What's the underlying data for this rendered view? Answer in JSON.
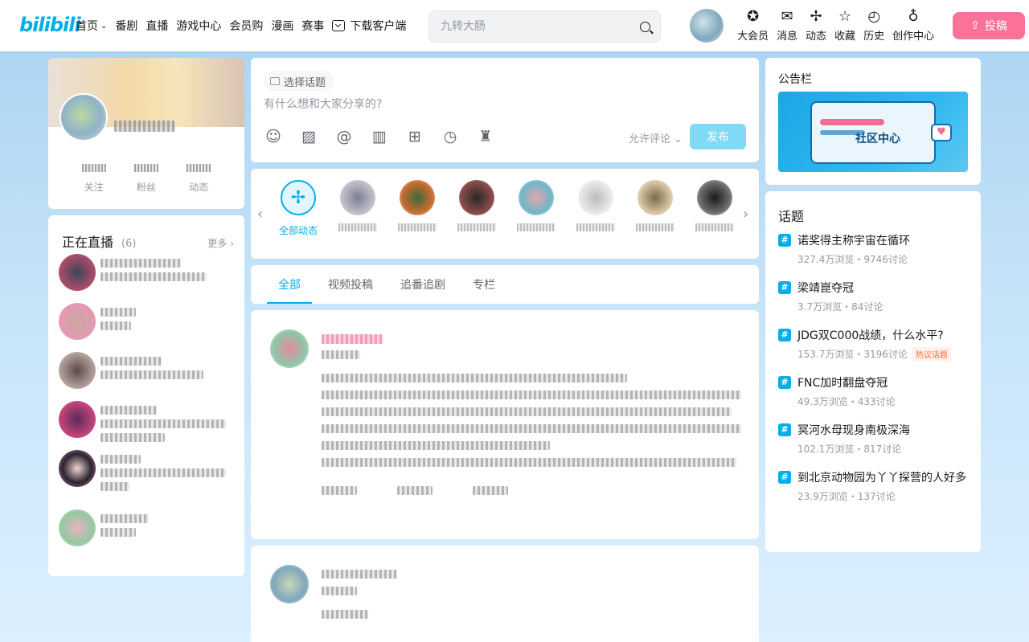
{
  "header": {
    "logo": "bilibili",
    "nav": [
      {
        "label": "首页",
        "chevron": true
      },
      {
        "label": "番剧"
      },
      {
        "label": "直播"
      },
      {
        "label": "游戏中心"
      },
      {
        "label": "会员购"
      },
      {
        "label": "漫画"
      },
      {
        "label": "赛事"
      },
      {
        "label": "下载客户端",
        "icon": "download-icon"
      }
    ],
    "search_placeholder": "九转大肠",
    "right_nav": [
      {
        "label": "大会员",
        "icon": "vip-icon",
        "glyph": "✪"
      },
      {
        "label": "消息",
        "icon": "message-icon",
        "glyph": "✉"
      },
      {
        "label": "动态",
        "icon": "dynamic-icon",
        "glyph": "✢"
      },
      {
        "label": "收藏",
        "icon": "favorite-icon",
        "glyph": "☆"
      },
      {
        "label": "历史",
        "icon": "history-icon",
        "glyph": "◴"
      },
      {
        "label": "创作中心",
        "icon": "bulb-icon",
        "glyph": "♁"
      }
    ],
    "upload_label": "投稿"
  },
  "profile": {
    "stats": [
      {
        "label": "关注"
      },
      {
        "label": "粉丝"
      },
      {
        "label": "动态"
      }
    ]
  },
  "live": {
    "title": "正在直播",
    "count": "(6)",
    "more": "更多"
  },
  "compose": {
    "topic_label": "选择话题",
    "placeholder": "有什么想和大家分享的?",
    "allow_comment": "允许评论",
    "publish": "发布"
  },
  "ups": {
    "all_label": "全部动态"
  },
  "tabs": [
    {
      "label": "全部",
      "active": true
    },
    {
      "label": "视频投稿"
    },
    {
      "label": "追番追剧"
    },
    {
      "label": "专栏"
    }
  ],
  "notice": {
    "title": "公告栏",
    "banner_text": "社区中心"
  },
  "topics": {
    "title": "话题",
    "items": [
      {
        "name": "诺奖得主称宇宙在循环",
        "meta": "327.4万浏览・9746讨论"
      },
      {
        "name": "梁靖崑夺冠",
        "meta": "3.7万浏览・84讨论"
      },
      {
        "name": "JDG双C000战绩，什么水平?",
        "meta": "153.7万浏览・3196讨论",
        "tag": "热议话题"
      },
      {
        "name": "FNC加时翻盘夺冠",
        "meta": "49.3万浏览・433讨论"
      },
      {
        "name": "冥河水母现身南极深海",
        "meta": "102.1万浏览・817讨论"
      },
      {
        "name": "到北京动物园为丫丫探营的人好多",
        "meta": "23.9万浏览・137讨论"
      }
    ]
  },
  "colors": {
    "brand": "#00aeec",
    "upload": "#fb7299",
    "publish": "#80daf6"
  }
}
